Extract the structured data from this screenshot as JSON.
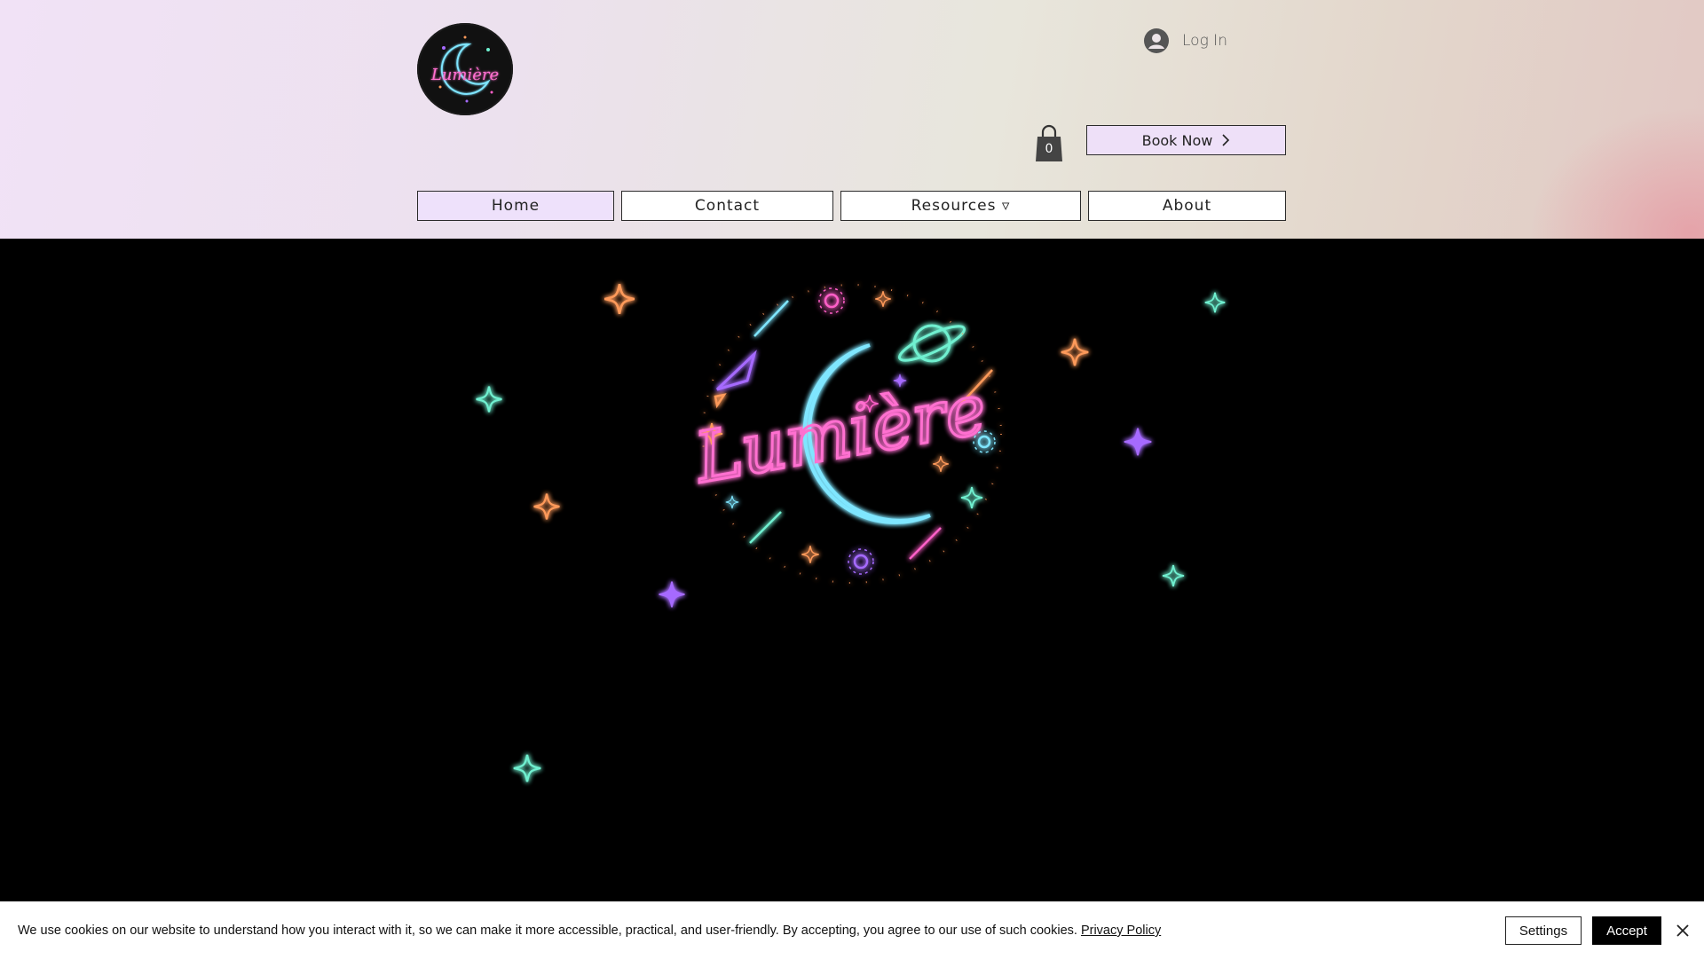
{
  "header": {
    "logo_text": "Lumière",
    "login_label": "Log In",
    "cart_count": "0",
    "book_now_label": "Book Now"
  },
  "nav": {
    "items": [
      {
        "label": "Home",
        "active": true
      },
      {
        "label": "Contact"
      },
      {
        "label": "Resources ▿"
      },
      {
        "label": "About"
      }
    ]
  },
  "hero": {
    "logo_text": "Lumière"
  },
  "cookie_banner": {
    "message": "We use cookies on our website to understand how you interact with it, so we can make it more accessible, practical, and user-friendly. By accepting, you agree to our use of such cookies.",
    "policy_link": "Privacy Policy",
    "settings_label": "Settings",
    "accept_label": "Accept"
  },
  "colors": {
    "accent_lavender": "#eee0f8",
    "neon_pink": "#ff5fc8",
    "neon_cyan": "#7fe6ff",
    "neon_orange": "#ff9a5a",
    "neon_purple": "#a66bff",
    "neon_teal": "#6ff0d0"
  },
  "icons": {
    "login": "user-circle-icon",
    "cart": "shopping-bag-icon",
    "book_now": "chevron-right-icon",
    "close": "close-icon",
    "sparkle": "four-point-star-icon"
  }
}
